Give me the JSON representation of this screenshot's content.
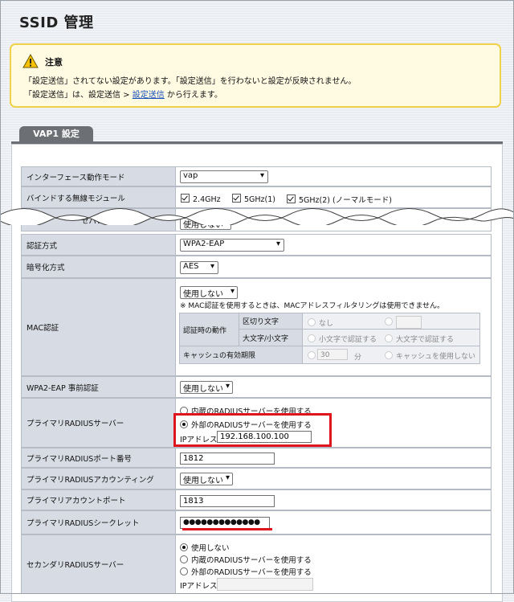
{
  "page": {
    "title": "SSID 管理"
  },
  "notice": {
    "heading": "注意",
    "line1": "「設定送信」されてない設定があります。「設定送信」を行わないと設定が反映されません。",
    "line2_prefix": "「設定送信」は、設定送信 > ",
    "line2_link": "設定送信",
    "line2_suffix": " から行えます。"
  },
  "tab": {
    "label": "VAP1 設定"
  },
  "rows": {
    "interface_mode": {
      "label": "インターフェース動作モード",
      "value": "vap"
    },
    "bind_module": {
      "label": "バインドする無線モジュール",
      "opt1": "2.4GHz",
      "opt2": "5GHz(1)",
      "opt3": "5GHz(2) (ノーマルモード)"
    },
    "separator": {
      "label": "セパレーター",
      "value": "使用しない"
    },
    "auth": {
      "label": "認証方式",
      "value": "WPA2-EAP"
    },
    "cipher": {
      "label": "暗号化方式",
      "value": "AES"
    },
    "mac": {
      "label": "MAC認証",
      "value": "使用しない",
      "note": "※ MAC認証を使用するときは、MACアドレスフィルタリングは使用できません。",
      "auth_action": "認証時の動作",
      "delimiter": "区切り文字",
      "none": "なし",
      "case": "大文字/小文字",
      "lower": "小文字で認証する",
      "upper": "大文字で認証する",
      "cache": "キャッシュの有効期限",
      "cache_value": "30",
      "minutes": "分",
      "no_cache": "キャッシュを使用しない"
    },
    "preauth": {
      "label": "WPA2-EAP 事前認証",
      "value": "使用しない"
    },
    "primary_radius": {
      "label": "プライマリRADIUSサーバー",
      "internal": "内蔵のRADIUSサーバーを使用する",
      "external": "外部のRADIUSサーバーを使用する",
      "ip_label": "IPアドレス",
      "ip_value": "192.168.100.100"
    },
    "primary_port": {
      "label": "プライマリRADIUSポート番号",
      "value": "1812"
    },
    "primary_accounting": {
      "label": "プライマリRADIUSアカウンティング",
      "value": "使用しない"
    },
    "primary_acct_port": {
      "label": "プライマリアカウントポート",
      "value": "1813"
    },
    "primary_secret": {
      "label": "プライマリRADIUSシークレット",
      "value": "●●●●●●●●●●●●●"
    },
    "secondary_radius": {
      "label": "セカンダリRADIUSサーバー",
      "unused": "使用しない",
      "internal": "内蔵のRADIUSサーバーを使用する",
      "external": "外部のRADIUSサーバーを使用する",
      "ip_label": "IPアドレス"
    }
  },
  "colors": {
    "highlight": "#e0141c",
    "label_bg": "#d7dbe3",
    "notice_border": "#f0d24a",
    "tab_bg": "#6c6f74"
  }
}
